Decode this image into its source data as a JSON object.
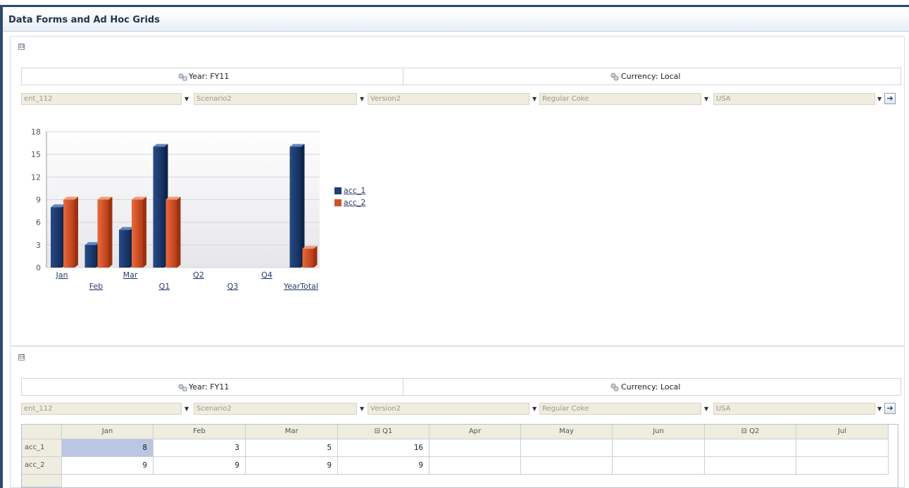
{
  "window": {
    "title": "Data Forms and Ad Hoc Grids"
  },
  "top_panel": {
    "collapse_symbol": "⊟",
    "pov": {
      "year_label": "Year: FY11",
      "currency_label": "Currency: Local"
    },
    "dropdowns": [
      "ent_112",
      "Scenario2",
      "Version2",
      "Regular Coke",
      "USA"
    ],
    "go_symbol": "➔"
  },
  "chart_data": {
    "type": "bar",
    "categories": [
      "Jan",
      "Feb",
      "Mar",
      "Q1",
      "Q2",
      "Q3",
      "Q4",
      "YearTotal"
    ],
    "series": [
      {
        "name": "acc_1",
        "values": [
          8,
          3,
          5,
          16,
          null,
          null,
          null,
          16
        ],
        "color": "#1f3f73"
      },
      {
        "name": "acc_2",
        "values": [
          9,
          9,
          9,
          9,
          null,
          null,
          null,
          2.5
        ],
        "color": "#d2502a"
      }
    ],
    "ylim": [
      0,
      18
    ],
    "yticks": [
      "0",
      "3",
      "6",
      "9",
      "12",
      "15",
      "18"
    ],
    "legend_position": "right",
    "grid": true
  },
  "bottom_panel": {
    "collapse_symbol": "⊟",
    "pov": {
      "year_label": "Year: FY11",
      "currency_label": "Currency: Local"
    },
    "dropdowns": [
      "ent_112",
      "Scenario2",
      "Version2",
      "Regular Coke",
      "USA"
    ],
    "go_symbol": "➔",
    "grid": {
      "columns": [
        "Jan",
        "Feb",
        "Mar",
        "⊟ Q1",
        "Apr",
        "May",
        "Jun",
        "⊟ Q2",
        "Jul"
      ],
      "rows": [
        {
          "label": "acc_1",
          "values": [
            "8",
            "3",
            "5",
            "16",
            "",
            "",
            "",
            "",
            ""
          ]
        },
        {
          "label": "acc_2",
          "values": [
            "9",
            "9",
            "9",
            "9",
            "",
            "",
            "",
            "",
            ""
          ]
        }
      ]
    }
  }
}
